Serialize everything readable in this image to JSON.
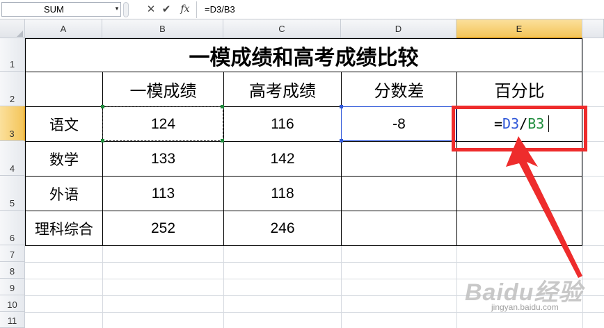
{
  "formula_bar": {
    "name_box": "SUM",
    "name_box_arrow": "▾",
    "cancel_icon": "✕",
    "enter_icon": "✔",
    "fx_label": "fx",
    "formula": "=D3/B3"
  },
  "columns": [
    "A",
    "B",
    "C",
    "D",
    "E"
  ],
  "selected_column": "E",
  "rows": [
    "1",
    "2",
    "3",
    "4",
    "5",
    "6",
    "7",
    "8",
    "9",
    "10",
    "11"
  ],
  "selected_row": "3",
  "sheet": {
    "title": "一模成绩和高考成绩比较",
    "headers": [
      "一模成绩",
      "高考成绩",
      "分数差",
      "百分比"
    ],
    "subjects": [
      "语文",
      "数学",
      "外语",
      "理科综合"
    ],
    "mock_scores": [
      "124",
      "133",
      "113",
      "252"
    ],
    "gaokao_scores": [
      "116",
      "142",
      "118",
      "246"
    ],
    "differences": [
      "-8",
      "",
      "",
      ""
    ]
  },
  "editing_cell": {
    "address": "E3",
    "prefix": "=",
    "ref1": "D3",
    "operator": "/",
    "ref2": "B3",
    "ref1_color": "#2f57d8",
    "ref2_color": "#1f8c3c"
  },
  "annotation": {
    "color": "#ee2c2c",
    "icons": [
      "red-highlight-box",
      "red-arrow-icon"
    ]
  },
  "watermark": {
    "logo": "Baidu经验",
    "url": "jingyan.baidu.com"
  }
}
